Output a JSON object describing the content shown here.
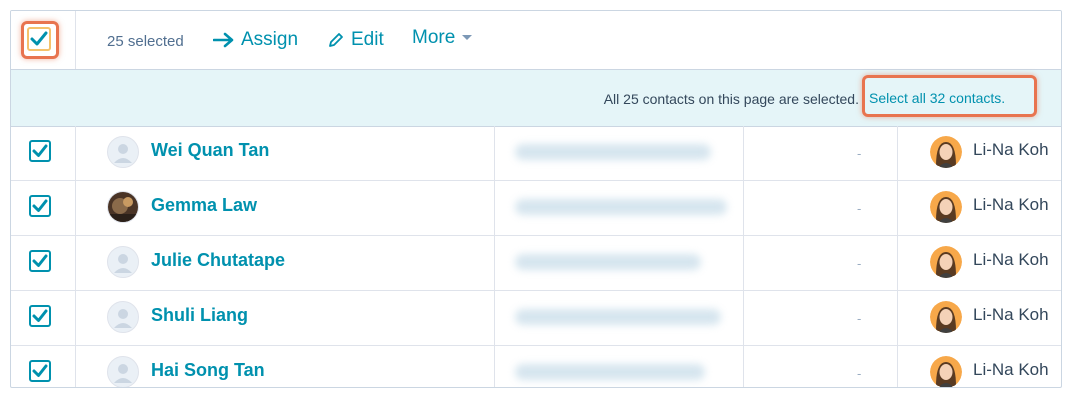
{
  "toolbar": {
    "selected_count": "25 selected",
    "assign_label": "Assign",
    "edit_label": "Edit",
    "more_label": "More"
  },
  "banner": {
    "text": "All 25 contacts on this page are selected.",
    "select_all_link": "Select all 32 contacts."
  },
  "contacts": [
    {
      "name": "Wei Quan Tan",
      "owner": "Li-Na Koh",
      "phone": "-",
      "avatar": "default"
    },
    {
      "name": "Gemma Law",
      "owner": "Li-Na Koh",
      "phone": "-",
      "avatar": "photo"
    },
    {
      "name": "Julie Chutatape",
      "owner": "Li-Na Koh",
      "phone": "-",
      "avatar": "default"
    },
    {
      "name": "Shuli Liang",
      "owner": "Li-Na Koh",
      "phone": "-",
      "avatar": "default"
    },
    {
      "name": "Hai Song Tan",
      "owner": "Li-Na Koh",
      "phone": "-",
      "avatar": "default"
    }
  ],
  "icons": {
    "assign": "arrow-right-icon",
    "edit": "pencil-icon",
    "more": "caret-down-icon",
    "checkbox": "checkmark-icon"
  },
  "colors": {
    "accent": "#0091ae",
    "highlight": "#e8744f",
    "banner_bg": "#e5f5f8",
    "text": "#33475b"
  }
}
